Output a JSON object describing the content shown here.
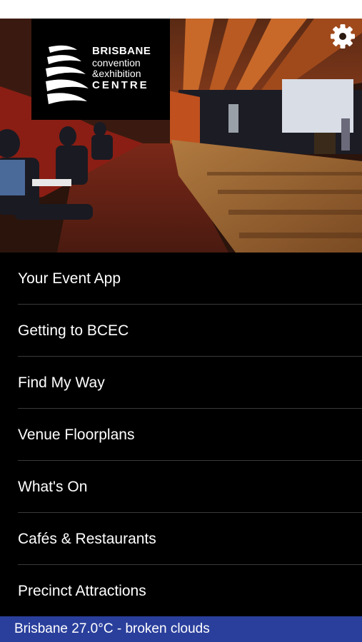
{
  "logo": {
    "line1": "BRISBANE",
    "line2": "convention",
    "line3": "&exhibition",
    "line4": "CENTRE"
  },
  "settings": {
    "icon": "gear-icon"
  },
  "menu": {
    "items": [
      {
        "label": "Your Event App"
      },
      {
        "label": "Getting to BCEC"
      },
      {
        "label": "Find My Way"
      },
      {
        "label": "Venue Floorplans"
      },
      {
        "label": "What's On"
      },
      {
        "label": "Cafés & Restaurants"
      },
      {
        "label": "Precinct Attractions"
      }
    ]
  },
  "weather": {
    "text": "Brisbane 27.0°C - broken clouds"
  },
  "colors": {
    "weather_bar": "#2a3f9c",
    "menu_background": "#000000",
    "menu_text": "#ffffff"
  }
}
